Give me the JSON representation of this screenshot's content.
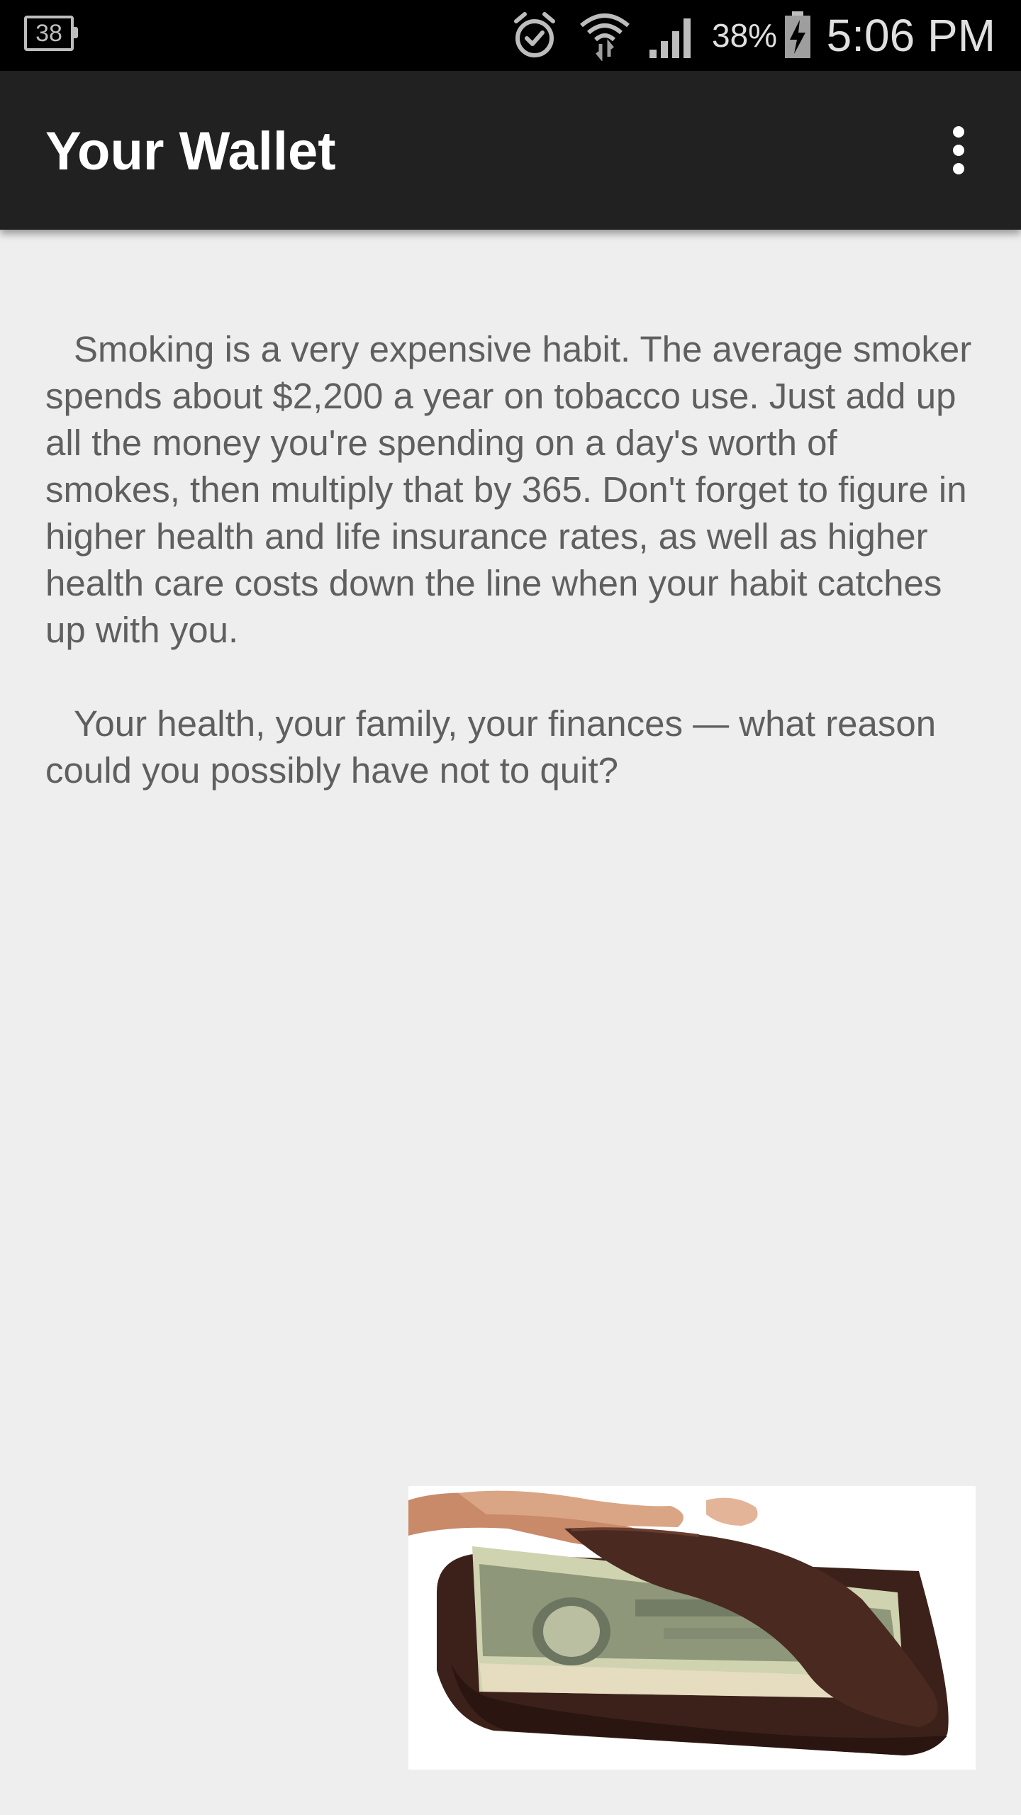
{
  "status_bar": {
    "notification_count": "38",
    "battery_percent": "38%",
    "time": "5:06 PM",
    "icons": [
      "notification-badge-icon",
      "alarm-icon",
      "wifi-icon",
      "cell-signal-icon",
      "battery-charging-icon"
    ]
  },
  "app_bar": {
    "title": "Your Wallet",
    "overflow_icon": "more-vertical-icon",
    "background": "#212121"
  },
  "content": {
    "paragraphs": [
      "Smoking is a very expensive habit. The average smoker spends about $2,200 a year on tobacco use. Just add up all the money you're spending on a day's worth of smokes, then multiply that by 365. Don't forget to figure in higher health and life insurance rates, as well as higher health care costs down the line when your habit catches up with you.",
      "Your health, your family, your finances — what reason could you possibly have not to quit?"
    ],
    "text_color": "#5f5f5f"
  },
  "image": {
    "depicts": "hand-holding-wallet-with-dollar-bills"
  }
}
